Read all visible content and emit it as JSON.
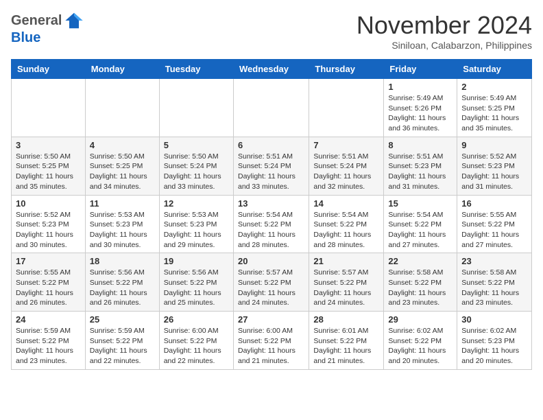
{
  "logo": {
    "general": "General",
    "blue": "Blue"
  },
  "header": {
    "month": "November 2024",
    "location": "Siniloan, Calabarzon, Philippines"
  },
  "weekdays": [
    "Sunday",
    "Monday",
    "Tuesday",
    "Wednesday",
    "Thursday",
    "Friday",
    "Saturday"
  ],
  "weeks": [
    [
      {
        "day": "",
        "info": ""
      },
      {
        "day": "",
        "info": ""
      },
      {
        "day": "",
        "info": ""
      },
      {
        "day": "",
        "info": ""
      },
      {
        "day": "",
        "info": ""
      },
      {
        "day": "1",
        "info": "Sunrise: 5:49 AM\nSunset: 5:26 PM\nDaylight: 11 hours and 36 minutes."
      },
      {
        "day": "2",
        "info": "Sunrise: 5:49 AM\nSunset: 5:25 PM\nDaylight: 11 hours and 35 minutes."
      }
    ],
    [
      {
        "day": "3",
        "info": "Sunrise: 5:50 AM\nSunset: 5:25 PM\nDaylight: 11 hours and 35 minutes."
      },
      {
        "day": "4",
        "info": "Sunrise: 5:50 AM\nSunset: 5:25 PM\nDaylight: 11 hours and 34 minutes."
      },
      {
        "day": "5",
        "info": "Sunrise: 5:50 AM\nSunset: 5:24 PM\nDaylight: 11 hours and 33 minutes."
      },
      {
        "day": "6",
        "info": "Sunrise: 5:51 AM\nSunset: 5:24 PM\nDaylight: 11 hours and 33 minutes."
      },
      {
        "day": "7",
        "info": "Sunrise: 5:51 AM\nSunset: 5:24 PM\nDaylight: 11 hours and 32 minutes."
      },
      {
        "day": "8",
        "info": "Sunrise: 5:51 AM\nSunset: 5:23 PM\nDaylight: 11 hours and 31 minutes."
      },
      {
        "day": "9",
        "info": "Sunrise: 5:52 AM\nSunset: 5:23 PM\nDaylight: 11 hours and 31 minutes."
      }
    ],
    [
      {
        "day": "10",
        "info": "Sunrise: 5:52 AM\nSunset: 5:23 PM\nDaylight: 11 hours and 30 minutes."
      },
      {
        "day": "11",
        "info": "Sunrise: 5:53 AM\nSunset: 5:23 PM\nDaylight: 11 hours and 30 minutes."
      },
      {
        "day": "12",
        "info": "Sunrise: 5:53 AM\nSunset: 5:23 PM\nDaylight: 11 hours and 29 minutes."
      },
      {
        "day": "13",
        "info": "Sunrise: 5:54 AM\nSunset: 5:22 PM\nDaylight: 11 hours and 28 minutes."
      },
      {
        "day": "14",
        "info": "Sunrise: 5:54 AM\nSunset: 5:22 PM\nDaylight: 11 hours and 28 minutes."
      },
      {
        "day": "15",
        "info": "Sunrise: 5:54 AM\nSunset: 5:22 PM\nDaylight: 11 hours and 27 minutes."
      },
      {
        "day": "16",
        "info": "Sunrise: 5:55 AM\nSunset: 5:22 PM\nDaylight: 11 hours and 27 minutes."
      }
    ],
    [
      {
        "day": "17",
        "info": "Sunrise: 5:55 AM\nSunset: 5:22 PM\nDaylight: 11 hours and 26 minutes."
      },
      {
        "day": "18",
        "info": "Sunrise: 5:56 AM\nSunset: 5:22 PM\nDaylight: 11 hours and 26 minutes."
      },
      {
        "day": "19",
        "info": "Sunrise: 5:56 AM\nSunset: 5:22 PM\nDaylight: 11 hours and 25 minutes."
      },
      {
        "day": "20",
        "info": "Sunrise: 5:57 AM\nSunset: 5:22 PM\nDaylight: 11 hours and 24 minutes."
      },
      {
        "day": "21",
        "info": "Sunrise: 5:57 AM\nSunset: 5:22 PM\nDaylight: 11 hours and 24 minutes."
      },
      {
        "day": "22",
        "info": "Sunrise: 5:58 AM\nSunset: 5:22 PM\nDaylight: 11 hours and 23 minutes."
      },
      {
        "day": "23",
        "info": "Sunrise: 5:58 AM\nSunset: 5:22 PM\nDaylight: 11 hours and 23 minutes."
      }
    ],
    [
      {
        "day": "24",
        "info": "Sunrise: 5:59 AM\nSunset: 5:22 PM\nDaylight: 11 hours and 23 minutes."
      },
      {
        "day": "25",
        "info": "Sunrise: 5:59 AM\nSunset: 5:22 PM\nDaylight: 11 hours and 22 minutes."
      },
      {
        "day": "26",
        "info": "Sunrise: 6:00 AM\nSunset: 5:22 PM\nDaylight: 11 hours and 22 minutes."
      },
      {
        "day": "27",
        "info": "Sunrise: 6:00 AM\nSunset: 5:22 PM\nDaylight: 11 hours and 21 minutes."
      },
      {
        "day": "28",
        "info": "Sunrise: 6:01 AM\nSunset: 5:22 PM\nDaylight: 11 hours and 21 minutes."
      },
      {
        "day": "29",
        "info": "Sunrise: 6:02 AM\nSunset: 5:22 PM\nDaylight: 11 hours and 20 minutes."
      },
      {
        "day": "30",
        "info": "Sunrise: 6:02 AM\nSunset: 5:23 PM\nDaylight: 11 hours and 20 minutes."
      }
    ]
  ]
}
